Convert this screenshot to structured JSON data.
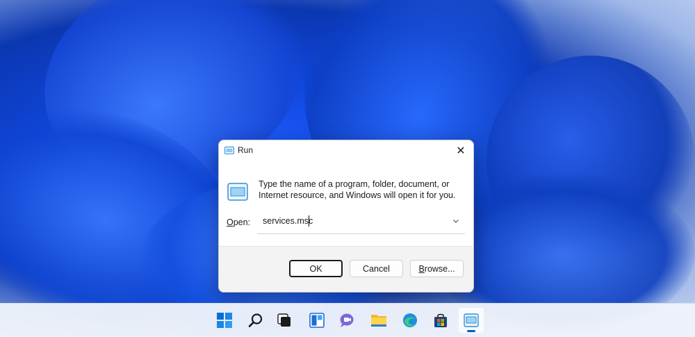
{
  "dialog": {
    "title": "Run",
    "close_label": "✕",
    "description": "Type the name of a program, folder, document, or Internet resource, and Windows will open it for you.",
    "open_label_underlined": "O",
    "open_label_rest": "pen:",
    "command_value": "services.msc",
    "ok_label": "OK",
    "cancel_label": "Cancel",
    "browse_label_underlined": "B",
    "browse_label_rest": "rowse..."
  },
  "taskbar": {
    "icons": [
      "windows-start-icon",
      "search-icon",
      "task-view-icon",
      "widgets-icon",
      "teams-chat-icon",
      "file-explorer-icon",
      "edge-browser-icon",
      "microsoft-store-icon",
      "run-app-icon"
    ],
    "active_item": "run-app-icon"
  },
  "colors": {
    "accent": "#0a58d0",
    "wallpaper": "#1450e0"
  }
}
